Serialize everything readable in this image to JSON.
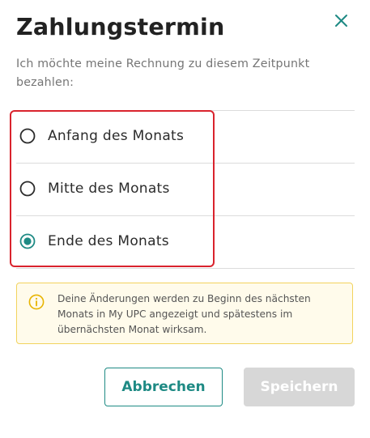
{
  "dialog": {
    "title": "Zahlungstermin",
    "subtitle": "Ich möchte meine Rechnung zu diesem Zeitpunkt bezahlen:",
    "close_icon": "close-icon"
  },
  "options": [
    {
      "label": "Anfang des Monats",
      "selected": false
    },
    {
      "label": "Mitte des Monats",
      "selected": false
    },
    {
      "label": "Ende des Monats",
      "selected": true
    }
  ],
  "info": {
    "icon": "info-icon",
    "text": "Deine Änderungen werden zu Beginn des nächsten Monats in My UPC angezeigt und spätestens im übernächsten Monat wirksam."
  },
  "buttons": {
    "cancel_label": "Abbrechen",
    "save_label": "Speichern",
    "save_disabled": true
  },
  "colors": {
    "accent": "#1e8a84",
    "highlight": "#d9232d",
    "info_background": "#fffbeb",
    "info_border": "#f2d35e",
    "info_icon": "#e8b400",
    "disabled": "#d7d7d7"
  }
}
